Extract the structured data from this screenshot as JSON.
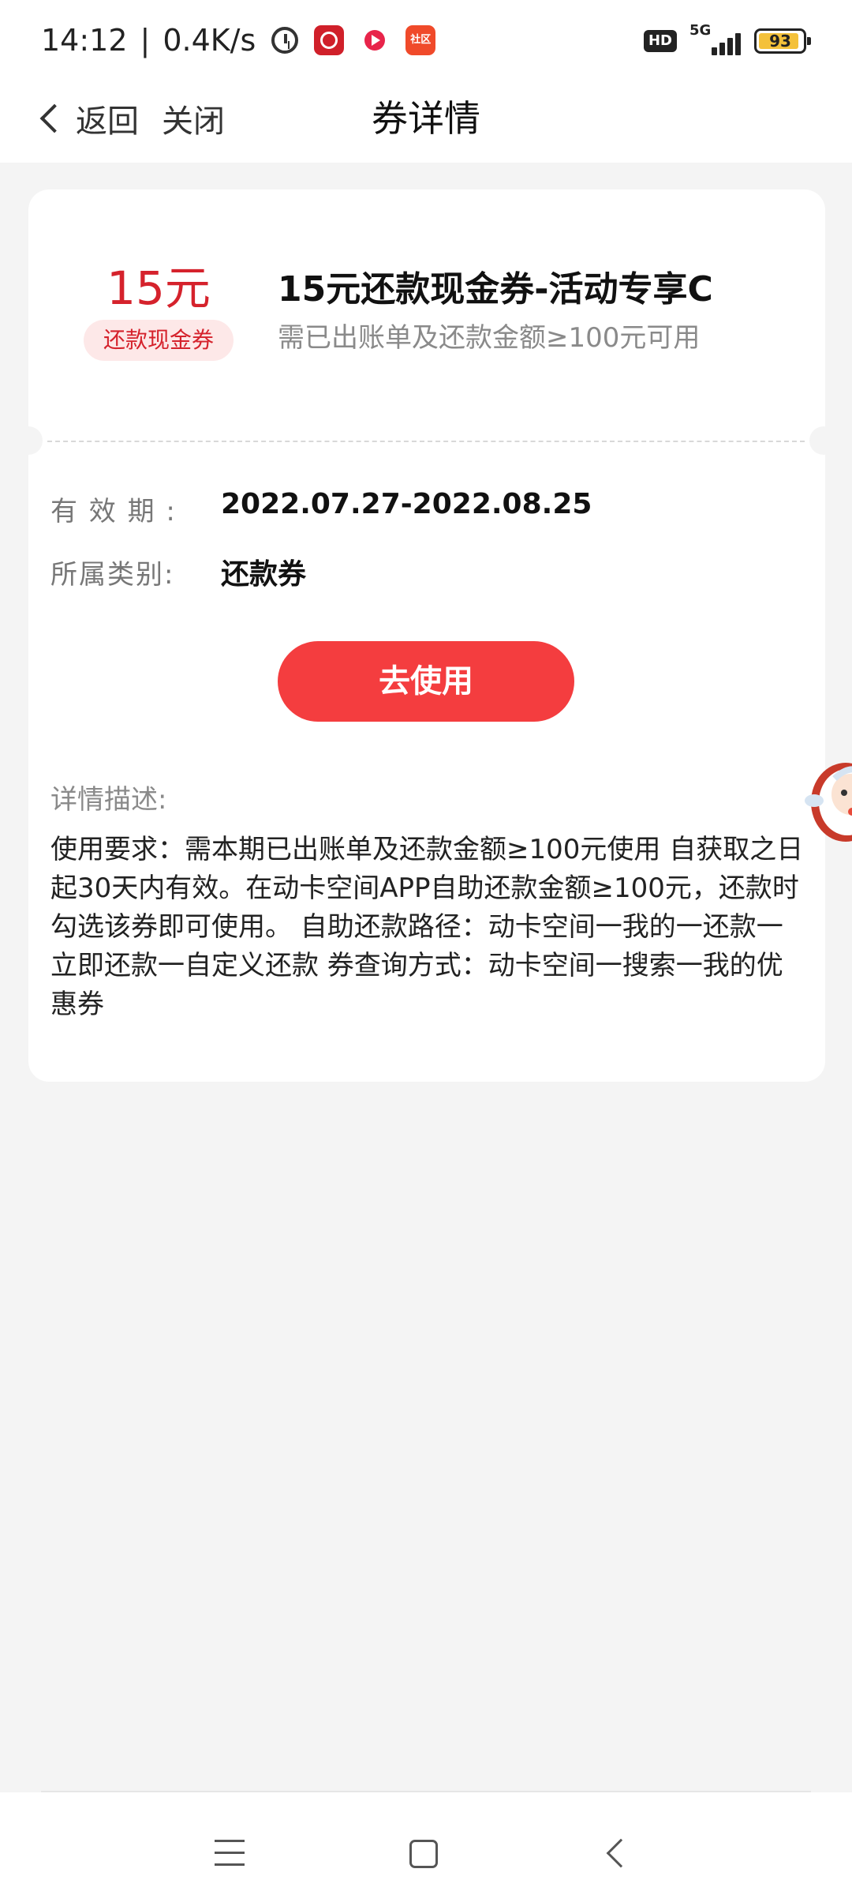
{
  "status_bar": {
    "time": "14:12",
    "net_speed": "0.4K/s",
    "separator": "|",
    "hd": "HD",
    "network": "5G",
    "battery": "93",
    "battery_level": 0.93,
    "icons": [
      "alarm-icon",
      "bank-app-icon",
      "video-app-icon",
      "community-app-icon"
    ],
    "community_label": "社区"
  },
  "nav": {
    "back_label": "返回",
    "close_label": "关闭",
    "title": "券详情"
  },
  "coupon": {
    "amount": "15元",
    "type": "还款现金券",
    "title": "15元还款现金券-活动专享C",
    "condition": "需已出账单及还款金额≥100元可用"
  },
  "details": {
    "validity_label": "有 效 期 :",
    "validity_value": "2022.07.27-2022.08.25",
    "category_label": "所属类别:",
    "category_value": "还款券"
  },
  "use_button": "去使用",
  "description": {
    "label": "详情描述:",
    "text": "使用要求：需本期已出账单及还款金额≥100元使用 自获取之日起30天内有效。在动卡空间APP自助还款金额≥100元，还款时勾选该券即可使用。 自助还款路径：动卡空间一我的一还款一立即还款一自定义还款 券查询方式：动卡空间一搜索一我的优惠券"
  },
  "colors": {
    "accent_red": "#d5222c",
    "button_red": "#f43d3f",
    "tag_bg": "#fde8e8",
    "page_bg": "#f4f4f4"
  }
}
